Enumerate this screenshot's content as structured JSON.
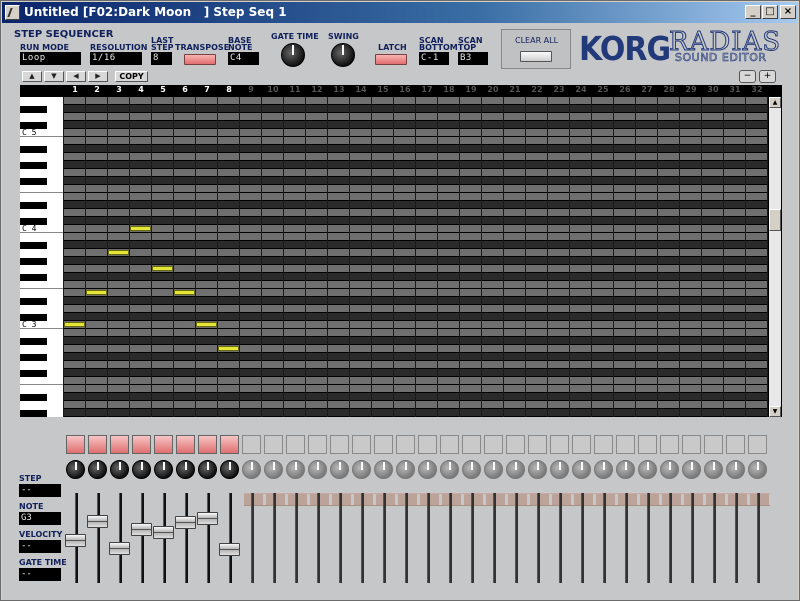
{
  "window": {
    "title": "Untitled [F02:Dark Moon   ] Step Seq 1",
    "controls": {
      "minimize": "_",
      "maximize": "□",
      "close": "×"
    }
  },
  "header": {
    "section_title": "STEP SEQUENCER",
    "run_mode": {
      "label": "RUN MODE",
      "value": "Loop"
    },
    "resolution": {
      "label": "RESOLUTION",
      "value": "1/16"
    },
    "last_step": {
      "label_1": "LAST",
      "label_2": "STEP",
      "value": "8"
    },
    "transpose": {
      "label": "TRANSPOSE"
    },
    "base_note": {
      "label_1": "BASE",
      "label_2": "NOTE",
      "value": "C4"
    },
    "gate_time": {
      "label": "GATE TIME"
    },
    "swing": {
      "label": "SWING"
    },
    "latch": {
      "label": "LATCH"
    },
    "scan_bottom": {
      "label_1": "SCAN",
      "label_2": "BOTTOM",
      "value": "C-1"
    },
    "scan_top": {
      "label_1": "SCAN",
      "label_2": "TOP",
      "value": "B3"
    },
    "clear_all": {
      "label": "CLEAR ALL"
    },
    "logo": {
      "brand": "KORG",
      "product": "RADIAS",
      "subtitle": "SOUND EDITOR"
    }
  },
  "toolbar": {
    "nav_up": "▲",
    "nav_down": "▼",
    "nav_left": "◀",
    "nav_right": "▶",
    "copy_label": "COPY",
    "zoom_out": "−",
    "zoom_in": "+"
  },
  "grid": {
    "step_numbers": [
      "1",
      "2",
      "3",
      "4",
      "5",
      "6",
      "7",
      "8",
      "9",
      "10",
      "11",
      "12",
      "13",
      "14",
      "15",
      "16",
      "17",
      "18",
      "19",
      "20",
      "21",
      "22",
      "23",
      "24",
      "25",
      "26",
      "27",
      "28",
      "29",
      "30",
      "31",
      "32"
    ],
    "active_steps": 8,
    "octave_labels": [
      "C 5",
      "C 4",
      "C 3"
    ],
    "notes": [
      {
        "step": 1,
        "pitch": "C3"
      },
      {
        "step": 2,
        "pitch": "E3"
      },
      {
        "step": 3,
        "pitch": "A3"
      },
      {
        "step": 4,
        "pitch": "C4"
      },
      {
        "step": 5,
        "pitch": "G3"
      },
      {
        "step": 6,
        "pitch": "E3"
      },
      {
        "step": 7,
        "pitch": "C3"
      },
      {
        "step": 8,
        "pitch": "A2"
      }
    ],
    "scroll": {
      "up": "▲",
      "down": "▼"
    }
  },
  "parameter_panel": {
    "step": {
      "label": "STEP",
      "value": "--"
    },
    "note": {
      "label": "NOTE",
      "value": "G3"
    },
    "velocity": {
      "label": "VELOCITY",
      "value": "--"
    },
    "gate_time": {
      "label": "GATE TIME",
      "value": "--"
    }
  },
  "step_levels": [
    0.49,
    0.73,
    0.39,
    0.62,
    0.59,
    0.71,
    0.76,
    0.38
  ]
}
